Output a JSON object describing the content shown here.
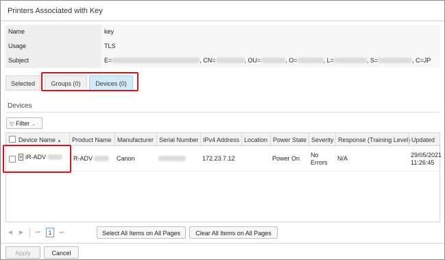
{
  "dialog": {
    "title": "Printers Associated with Key"
  },
  "properties": [
    {
      "label": "Name",
      "value": "key"
    },
    {
      "label": "Usage",
      "value": "TLS"
    },
    {
      "label": "Subject",
      "parts": [
        "E=",
        ", CN=",
        ", OU=",
        ", O=",
        ", L=",
        ", S=",
        ", C=JP"
      ]
    }
  ],
  "tabs": {
    "selected": "Selected",
    "groups": "Groups (0)",
    "devices": "Devices (0)",
    "active": "devices"
  },
  "devices_section": {
    "title": "Devices",
    "filter_label": "Filter",
    "filter_icon": "funnel-icon",
    "filter_chevron": "chevron-down-icon"
  },
  "table": {
    "columns": [
      "Device Name",
      "Product Name",
      "Manufacturer",
      "Serial Number",
      "IPv4 Address",
      "Location",
      "Power State",
      "Severity",
      "Response (Training Level)",
      "Updated"
    ],
    "sort_indicator": "▲",
    "rows": [
      {
        "device_name": "iR-ADV",
        "product_name": "R-ADV",
        "manufacturer": "Canon",
        "serial_number": "",
        "ipv4": "172.23.7.12",
        "location": "",
        "power_state": "Power On",
        "severity_line1": "No",
        "severity_line2": "Errors",
        "response": "N/A",
        "updated_date": "29/05/2021",
        "updated_time": "11:26:45",
        "checked": false
      }
    ]
  },
  "pager": {
    "prev_icon": "◀",
    "next_icon": "▶",
    "first_icon": "⏮",
    "last_icon": "⏭",
    "current_page": "1"
  },
  "actions": {
    "select_all": "Select All Items on All Pages",
    "clear_all": "Clear All Items on All Pages",
    "apply": "Apply",
    "cancel": "Cancel"
  },
  "colors": {
    "highlight": "#e0101a",
    "active_tab": "#d4eaf7"
  }
}
